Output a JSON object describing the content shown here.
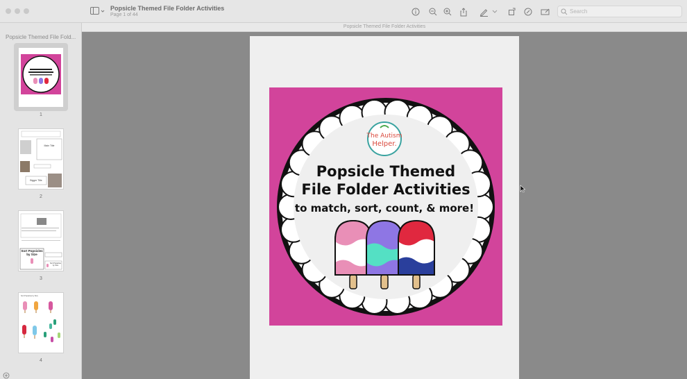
{
  "window": {
    "title": "Popsicle Themed File Folder Activities",
    "subtitle": "Page 1 of 44",
    "header_title": "Popsicle Themed File Folder Activities"
  },
  "search": {
    "placeholder": "Search"
  },
  "sidebar": {
    "title": "Popsicle Themed File Fold...",
    "pages": [
      {
        "number": "1"
      },
      {
        "number": "2",
        "labels": [
          "Main Title",
          "Bigger Title"
        ]
      },
      {
        "number": "3",
        "labels": [
          "Sort Popsicles by Size",
          "Sort Popsicles by Size"
        ]
      },
      {
        "number": "4",
        "heading": "Sort Popsicles by Size"
      }
    ]
  },
  "cover": {
    "logo_line1": "The Autism",
    "logo_line2": "Helper.",
    "title_line1": "Popsicle Themed",
    "title_line2": "File Folder Activities",
    "tagline": "to match, sort, count, & more!",
    "colors": {
      "background": "#d2449b",
      "pink": "#e98fb7",
      "purple": "#8e76e4",
      "mint": "#54e0c4",
      "red": "#e0283f",
      "blue": "#2a3f9c"
    }
  }
}
